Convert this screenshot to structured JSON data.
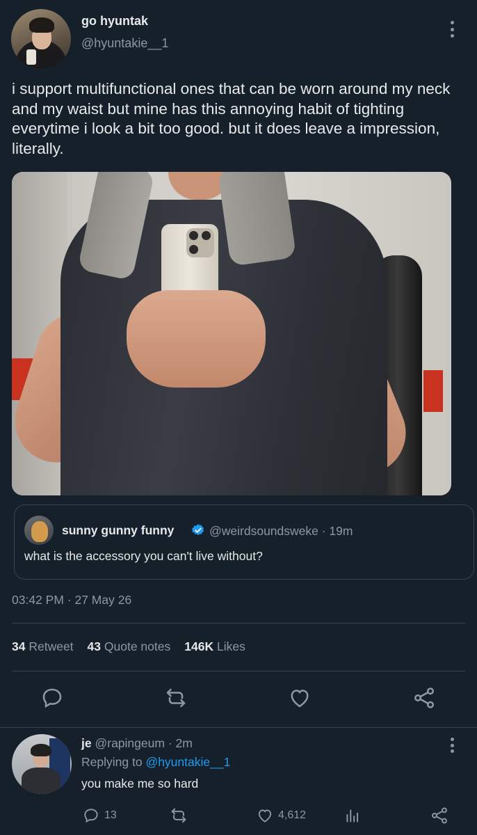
{
  "tweet": {
    "display_name": "go hyuntak",
    "handle": "@hyuntakie__1",
    "text": "i support multifunctional ones that can be worn around my neck and my waist but mine has this annoying habit of tighting everytime i look a bit too good. but it does leave a impression, literally.",
    "timestamp": "03:42 PM · 27 May 26",
    "stats": {
      "retweets": "34",
      "retweets_label": "Retweet",
      "quotes": "43",
      "quotes_label": "Quote notes",
      "likes": "146K",
      "likes_label": "Likes"
    }
  },
  "quoted": {
    "display_name": "sunny gunny funny",
    "handle_time": "@weirdsoundsweke · 19m",
    "text": "what is the accessory you can't live without?"
  },
  "reply": {
    "display_name": "je",
    "handle_time": "@rapingeum · 2m",
    "replying_prefix": "Replying to",
    "replying_to": "@hyuntakie__1",
    "text": "you make me so hard",
    "reply_count": "13",
    "like_count": "4,612"
  },
  "icons": [
    "more-icon",
    "verified-icon",
    "reply-icon",
    "retweet-icon",
    "like-icon",
    "share-icon",
    "analytics-icon"
  ],
  "colors": {
    "background": "#15202b",
    "text": "#e7e9ea",
    "muted": "#8b98a5",
    "link": "#1d9bf0",
    "border": "#38444d"
  }
}
